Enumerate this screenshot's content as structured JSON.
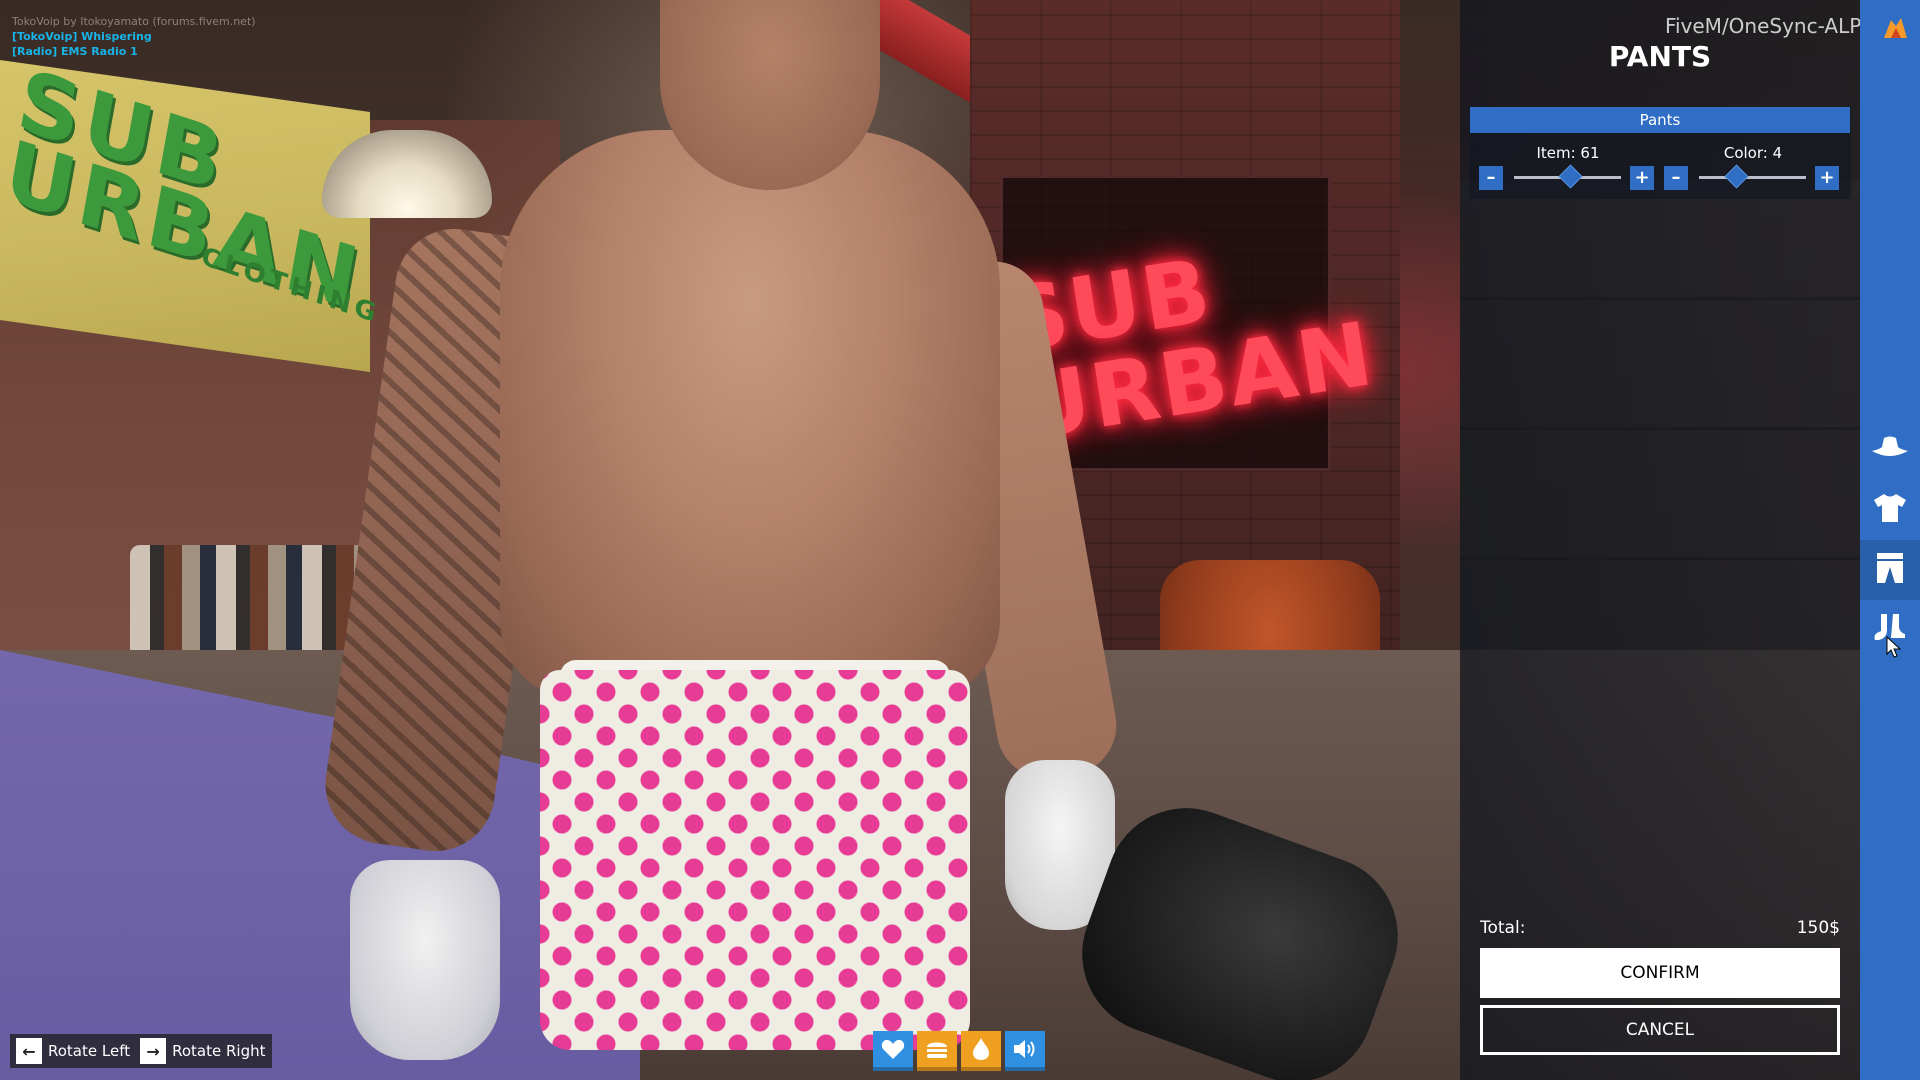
{
  "hud": {
    "voip_credit": "TokoVoip by Itokoyamato (forums.fivem.net)",
    "voip_whispering": "[TokoVoip] Whispering",
    "voip_radio": "[Radio] EMS Radio 1"
  },
  "controls": {
    "rotate_left": "Rotate Left",
    "rotate_right": "Rotate Right",
    "rotate_left_key": "←",
    "rotate_right_key": "→"
  },
  "hotbar": [
    {
      "icon": "heart-icon",
      "color": "#2f8fe0"
    },
    {
      "icon": "burger-icon",
      "color": "#f0a020"
    },
    {
      "icon": "water-drop-icon",
      "color": "#f0a020"
    },
    {
      "icon": "speaker-icon",
      "color": "#2f8fe0"
    }
  ],
  "panel": {
    "server_name": "FiveM/OneSync-ALPHA",
    "title": "PANTS",
    "section_header": "Pants",
    "item_label": "Item: 61",
    "color_label": "Color: 4",
    "item_value_fraction": 0.52,
    "color_value_fraction": 0.35,
    "minus_symbol": "–",
    "plus_symbol": "+",
    "total_label": "Total:",
    "total_value": "150$",
    "confirm_label": "CONFIRM",
    "cancel_label": "CANCEL"
  },
  "sidebar": {
    "items": [
      {
        "icon": "hat-icon"
      },
      {
        "icon": "tshirt-icon"
      },
      {
        "icon": "pants-icon",
        "active": true
      },
      {
        "icon": "shoes-icon"
      }
    ],
    "accent": "#2f6ec4"
  },
  "scene": {
    "banner_text_top": "SUB",
    "banner_text_bottom": "URBAN",
    "banner_sub": "CLOTHING",
    "neon_text_top": "SUB",
    "neon_text_bottom": "URBAN"
  }
}
